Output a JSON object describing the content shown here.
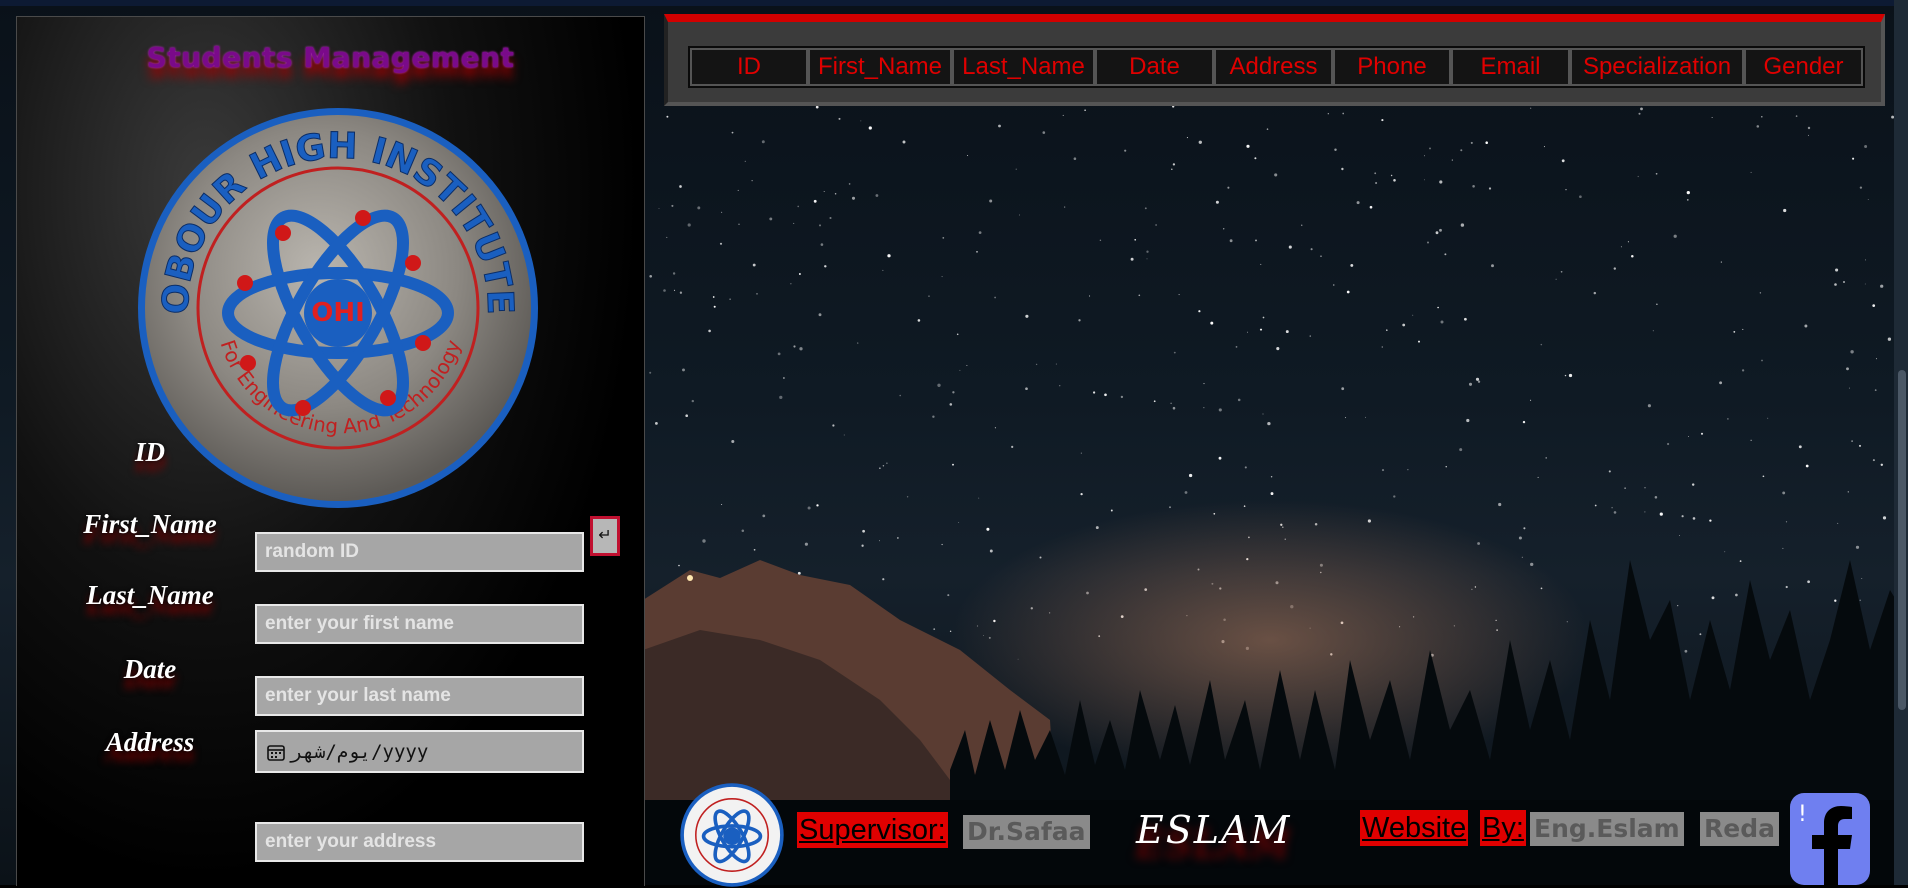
{
  "panel": {
    "title": "Students Management",
    "logo_text_top": "OBOUR HIGH INSTITUTE",
    "logo_text_bottom": "For Engineering And Technology",
    "logo_abbr": "OHI",
    "fields": {
      "id": {
        "label": "ID",
        "placeholder": "random ID"
      },
      "first_name": {
        "label": "First_Name",
        "placeholder": "enter your first name"
      },
      "last_name": {
        "label": "Last_Name",
        "placeholder": "enter your last name"
      },
      "date": {
        "label": "Date",
        "value": "يوم/شهر/yyyy"
      },
      "address": {
        "label": "Address",
        "placeholder": "enter your address"
      }
    },
    "random_button_glyph": "↵"
  },
  "table": {
    "columns": [
      "ID",
      "First_Name",
      "Last_Name",
      "Date",
      "Address",
      "Phone",
      "Email",
      "Specialization",
      "Gender"
    ]
  },
  "footer": {
    "supervisor_label": "Supervisor:",
    "supervisor_name": "Dr.Safaa",
    "signature": "ESLAM",
    "website_word": "Website",
    "by_word": "By:",
    "author_first": "Eng.Eslam",
    "author_last": "Reda",
    "social_icon": "facebook-icon"
  },
  "colors": {
    "accent_red": "#e00000",
    "title_purple": "#7a0a8a",
    "logo_blue": "#1a5fc0",
    "facebook_blue": "#6f7ff0"
  }
}
